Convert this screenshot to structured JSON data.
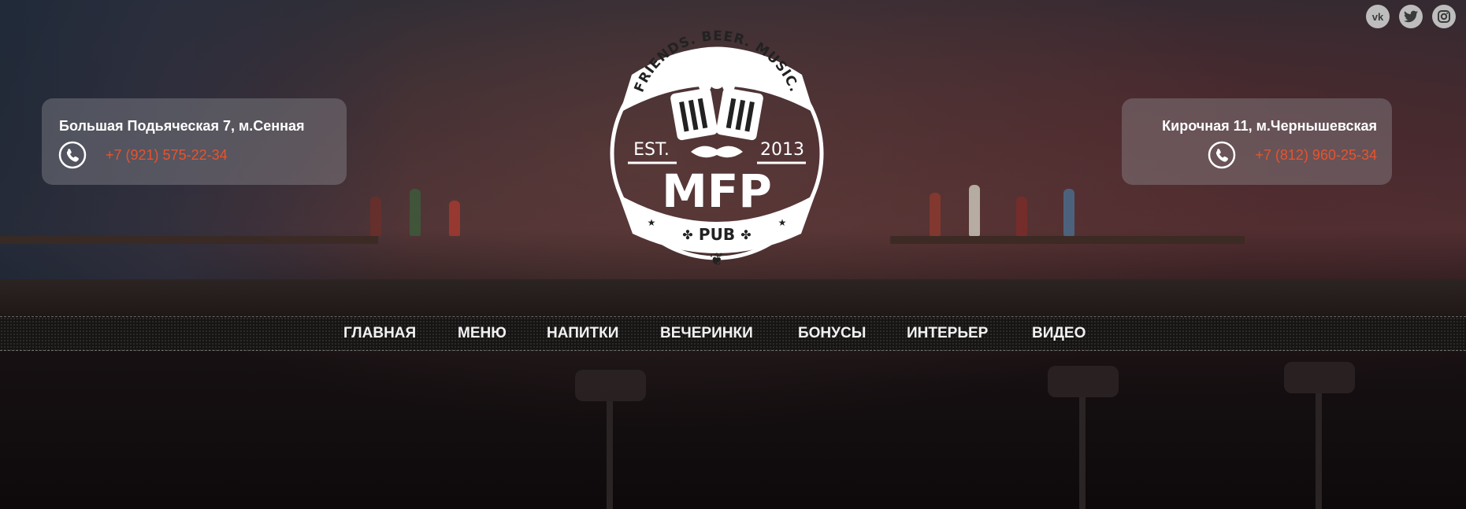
{
  "locations": [
    {
      "address": "Большая Подьяческая 7, м.Сенная",
      "phone": "+7 (921) 575-22-34"
    },
    {
      "address": "Кирочная 11, м.Чернышевская",
      "phone": "+7 (812) 960-25-34"
    }
  ],
  "social": [
    {
      "icon": "vk-icon",
      "glyph": "vk"
    },
    {
      "icon": "twitter-icon",
      "glyph": ""
    },
    {
      "icon": "instagram-icon",
      "glyph": ""
    }
  ],
  "logo": {
    "top_arc": "FRIENDS. BEER. MUSIC.",
    "est": "EST.",
    "year": "2013",
    "name": "MFP",
    "sub": "PUB"
  },
  "nav": {
    "items": [
      "ГЛАВНАЯ",
      "МЕНЮ",
      "НАПИТКИ",
      "ВЕЧЕРИНКИ",
      "БОНУСЫ",
      "ИНТЕРЬЕР",
      "ВИДЕО"
    ]
  },
  "colors": {
    "accent": "#e8532d",
    "nav_text": "#f1f1f1"
  }
}
